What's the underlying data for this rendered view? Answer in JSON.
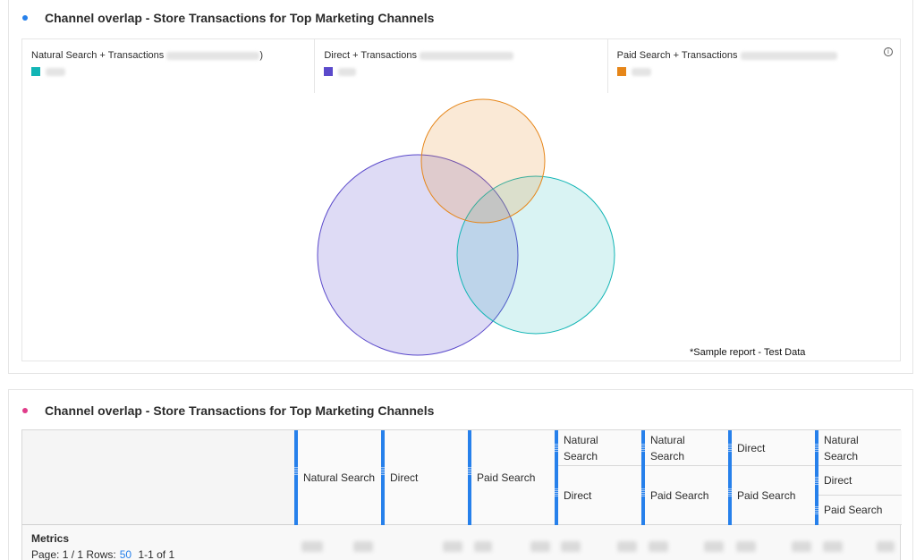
{
  "panel1": {
    "title": "Channel overlap - Store Transactions for Top Marketing Channels",
    "dot_color": "#2680eb",
    "legend": [
      {
        "label": "Natural Search + Transactions",
        "suffix": ")",
        "color": "#12b5b5"
      },
      {
        "label": "Direct + Transactions",
        "suffix": "",
        "color": "#5b4acb"
      },
      {
        "label": "Paid Search + Transactions",
        "suffix": "",
        "color": "#e68619"
      }
    ],
    "info_icon": "info-icon",
    "sample_note": "*Sample report - Test Data",
    "venn_colors": {
      "orange": "#e68619",
      "purple": "#5b4acb",
      "teal": "#12b5b5"
    }
  },
  "panel2": {
    "title": "Channel overlap - Store Transactions for Top Marketing Channels",
    "dot_color": "#e03c8a",
    "columns": [
      {
        "cells": [
          "Natural Search"
        ]
      },
      {
        "cells": [
          "Direct"
        ]
      },
      {
        "cells": [
          "Paid Search"
        ]
      },
      {
        "cells": [
          "Natural Search",
          "Direct"
        ]
      },
      {
        "cells": [
          "Natural Search",
          "Paid Search"
        ]
      },
      {
        "cells": [
          "Direct",
          "Paid Search"
        ]
      },
      {
        "cells": [
          "Natural Search",
          "Direct",
          "Paid Search"
        ]
      }
    ],
    "metrics_label": "Metrics",
    "pager": {
      "page": "Page: 1 / 1",
      "rows_label": "Rows:",
      "rows_value": "50",
      "range": "1-1 of 1"
    }
  }
}
